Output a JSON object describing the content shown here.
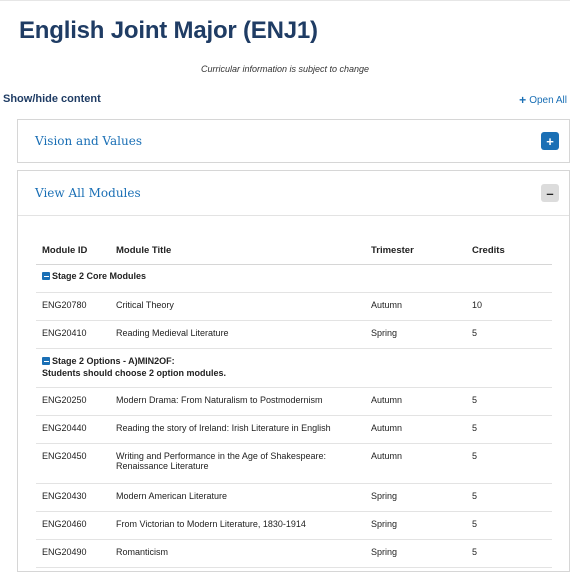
{
  "page": {
    "title": "English Joint Major (ENJ1)",
    "notice": "Curricular information is subject to change",
    "show_hide_label": "Show/hide content",
    "open_all_label": "Open All",
    "open_all_icon": "+"
  },
  "panels": {
    "vision": {
      "title": "Vision and Values",
      "toggle": "+"
    },
    "modules": {
      "title": "View All Modules",
      "toggle": "–"
    }
  },
  "table": {
    "headers": {
      "id": "Module ID",
      "title": "Module Title",
      "trimester": "Trimester",
      "credits": "Credits"
    },
    "group_core": {
      "label": "Stage 2 Core Modules"
    },
    "core_rows": [
      {
        "id": "ENG20780",
        "title": "Critical Theory",
        "trimester": "Autumn",
        "credits": "10"
      },
      {
        "id": "ENG20410",
        "title": "Reading Medieval Literature",
        "trimester": "Spring",
        "credits": "5"
      }
    ],
    "group_options": {
      "label": "Stage 2 Options - A)MIN2OF:",
      "note": "Students should choose 2 option modules."
    },
    "option_rows": [
      {
        "id": "ENG20250",
        "title": "Modern Drama: From Naturalism to Postmodernism",
        "trimester": "Autumn",
        "credits": "5"
      },
      {
        "id": "ENG20440",
        "title": "Reading the story of Ireland: Irish Literature in English",
        "trimester": "Autumn",
        "credits": "5"
      },
      {
        "id": "ENG20450",
        "title": "Writing and Performance in the Age of Shakespeare: Renaissance Literature",
        "trimester": "Autumn",
        "credits": "5"
      },
      {
        "id": "ENG20430",
        "title": "Modern American Literature",
        "trimester": "Spring",
        "credits": "5"
      },
      {
        "id": "ENG20460",
        "title": "From Victorian to Modern Literature, 1830-1914",
        "trimester": "Spring",
        "credits": "5"
      },
      {
        "id": "ENG20490",
        "title": "Romanticism",
        "trimester": "Spring",
        "credits": "5"
      }
    ]
  },
  "colors": {
    "heading": "#1f3c64",
    "link": "#1a6fb5",
    "border": "#d6d6d6"
  }
}
